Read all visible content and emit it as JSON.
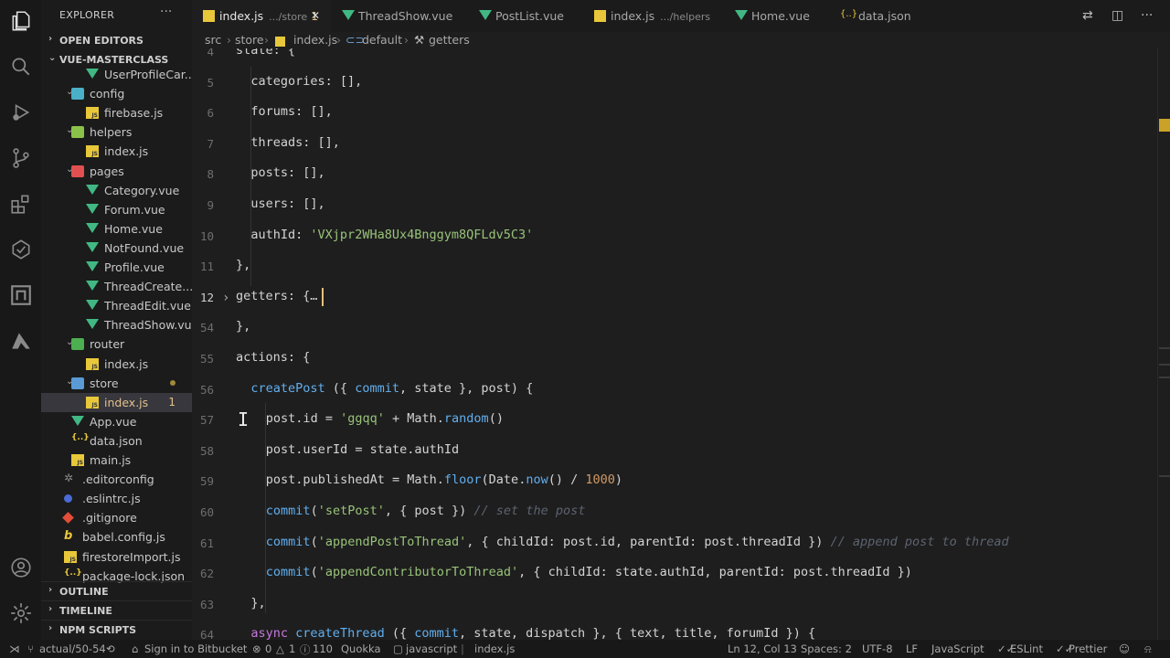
{
  "explorer": {
    "title": "EXPLORER",
    "more": "···",
    "open_editors": "OPEN EDITORS",
    "project": "VUE-MASTERCLASS",
    "outline": "OUTLINE",
    "timeline": "TIMELINE",
    "npm_scripts": "NPM SCRIPTS",
    "tree": [
      {
        "name": "UserProfileCar...",
        "type": "vue"
      },
      {
        "name": "config",
        "type": "folder"
      },
      {
        "name": "firebase.js",
        "type": "js"
      },
      {
        "name": "helpers",
        "type": "folder"
      },
      {
        "name": "index.js",
        "type": "js"
      },
      {
        "name": "pages",
        "type": "folder"
      },
      {
        "name": "Category.vue",
        "type": "vue"
      },
      {
        "name": "Forum.vue",
        "type": "vue"
      },
      {
        "name": "Home.vue",
        "type": "vue"
      },
      {
        "name": "NotFound.vue",
        "type": "vue"
      },
      {
        "name": "Profile.vue",
        "type": "vue"
      },
      {
        "name": "ThreadCreate...",
        "type": "vue"
      },
      {
        "name": "ThreadEdit.vue",
        "type": "vue"
      },
      {
        "name": "ThreadShow.vue",
        "type": "vue"
      },
      {
        "name": "router",
        "type": "folder"
      },
      {
        "name": "index.js",
        "type": "js"
      },
      {
        "name": "store",
        "type": "folder"
      },
      {
        "name": "index.js",
        "type": "js",
        "badge": "1"
      },
      {
        "name": "App.vue",
        "type": "vue"
      },
      {
        "name": "data.json",
        "type": "json"
      },
      {
        "name": "main.js",
        "type": "js"
      },
      {
        "name": ".editorconfig",
        "type": "gear"
      },
      {
        "name": ".eslintrc.js",
        "type": "eslint"
      },
      {
        "name": ".gitignore",
        "type": "git"
      },
      {
        "name": "babel.config.js",
        "type": "babel"
      },
      {
        "name": "firestoreImport.js",
        "type": "js"
      },
      {
        "name": "package-lock.json",
        "type": "json"
      }
    ]
  },
  "tabs": [
    {
      "name": "index.js",
      "sub": ".../store",
      "mod": "1",
      "type": "js",
      "active": true
    },
    {
      "name": "ThreadShow.vue",
      "type": "vue"
    },
    {
      "name": "PostList.vue",
      "type": "vue"
    },
    {
      "name": "index.js",
      "sub": ".../helpers",
      "type": "js"
    },
    {
      "name": "Home.vue",
      "type": "vue"
    },
    {
      "name": "data.json",
      "type": "json"
    }
  ],
  "breadcrumb": {
    "parts": [
      "src",
      "store",
      "index.js",
      "default",
      "getters"
    ],
    "sep": "›"
  },
  "code": {
    "lines": [
      {
        "n": "4",
        "indent": 1,
        "text": "state: {"
      },
      {
        "n": "5",
        "indent": 2,
        "text": "categories: [],"
      },
      {
        "n": "6",
        "indent": 2,
        "text": "forums: [],"
      },
      {
        "n": "7",
        "indent": 2,
        "text": "threads: [],"
      },
      {
        "n": "8",
        "indent": 2,
        "text": "posts: [],"
      },
      {
        "n": "9",
        "indent": 2,
        "text": "users: [],"
      },
      {
        "n": "10",
        "indent": 2,
        "text": "authId: 'VXjpr2WHa8Ux4Bnggym8QFLdv5C3'"
      },
      {
        "n": "11",
        "indent": 1,
        "text": "},"
      },
      {
        "n": "12",
        "indent": 1,
        "text": "getters: {…"
      },
      {
        "n": "54",
        "indent": 1,
        "text": "},"
      },
      {
        "n": "55",
        "indent": 1,
        "text": "actions: {"
      },
      {
        "n": "56",
        "indent": 2,
        "text": "createPost ({ commit, state }, post) {"
      },
      {
        "n": "57",
        "indent": 3,
        "text": "post.id = 'ggqq' + Math.random()"
      },
      {
        "n": "58",
        "indent": 3,
        "text": "post.userId = state.authId"
      },
      {
        "n": "59",
        "indent": 3,
        "text": "post.publishedAt = Math.floor(Date.now() / 1000)"
      },
      {
        "n": "60",
        "indent": 3,
        "text": "commit('setPost', { post }) // set the post"
      },
      {
        "n": "61",
        "indent": 3,
        "text": "commit('appendPostToThread', { childId: post.id, parentId: post.threadId }) // append post to thread"
      },
      {
        "n": "62",
        "indent": 3,
        "text": "commit('appendContributorToThread', { childId: state.authId, parentId: post.threadId })"
      },
      {
        "n": "63",
        "indent": 2,
        "text": "},"
      },
      {
        "n": "64",
        "indent": 2,
        "text": "async createThread ({ commit, state, dispatch }, { text, title, forumId }) {"
      }
    ]
  },
  "status": {
    "branch": "actual/50-54",
    "sign_in": "Sign in to Bitbucket",
    "errors": "0",
    "warnings": "1",
    "info": "110",
    "quokka": "Quokka",
    "lang_crumb": "javascript",
    "file_crumb": "index.js",
    "position": "Ln 12, Col 13",
    "spaces": "Spaces: 2",
    "encoding": "UTF-8",
    "eol": "LF",
    "language": "JavaScript",
    "eslint": "ESLint",
    "prettier": "Prettier"
  },
  "colors": {
    "accent_badge": "#e2c08d",
    "string": "#98c379",
    "function": "#61afef",
    "number": "#d19a66",
    "comment": "#5c6370"
  }
}
